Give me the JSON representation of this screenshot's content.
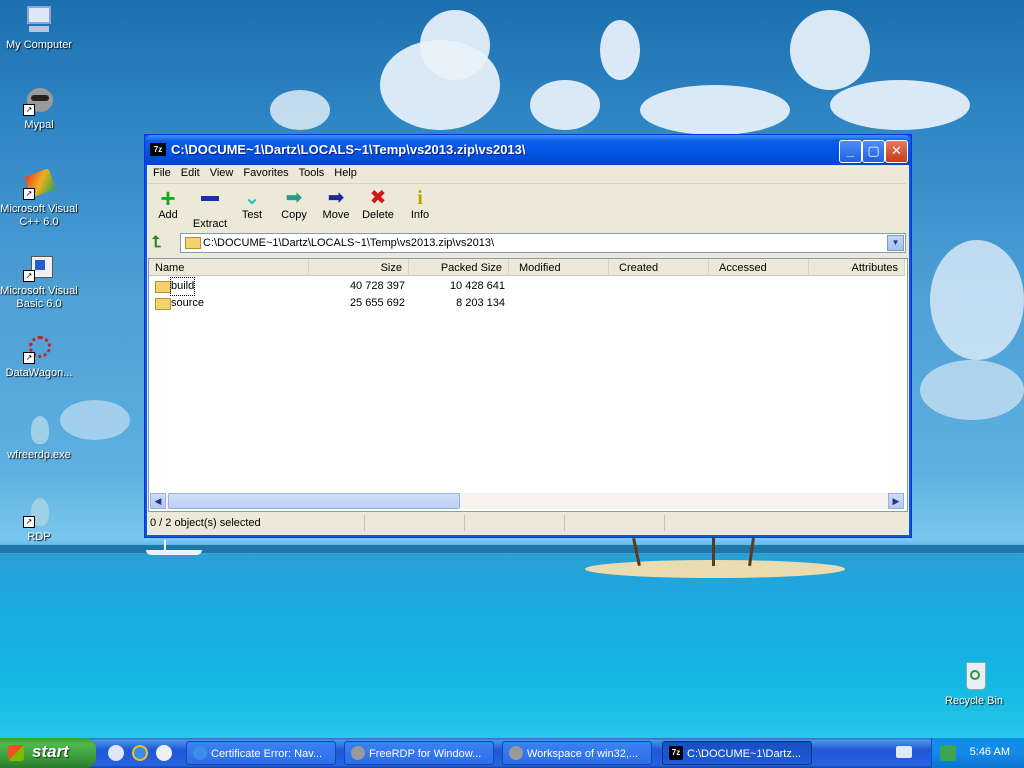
{
  "desktop": {
    "icons": [
      {
        "label": "My Computer",
        "icon": "my-computer-icon"
      },
      {
        "label": "Mypal",
        "icon": "raccoon-browser-icon"
      },
      {
        "label": "Microsoft Visual C++ 6.0",
        "icon": "visual-cpp-icon"
      },
      {
        "label": "Microsoft Visual Basic 6.0",
        "icon": "visual-basic-icon"
      },
      {
        "label": "DataWagon...",
        "icon": "datawagon-icon"
      },
      {
        "label": "wfreerdp.exe",
        "icon": "freerdp-icon"
      },
      {
        "label": "RDP",
        "icon": "freerdp-icon"
      },
      {
        "label": "Recycle Bin",
        "icon": "recycle-bin-icon"
      }
    ]
  },
  "window": {
    "app_icon": "7z",
    "title": "C:\\DOCUME~1\\Dartz\\LOCALS~1\\Temp\\vs2013.zip\\vs2013\\",
    "menu": [
      "File",
      "Edit",
      "View",
      "Favorites",
      "Tools",
      "Help"
    ],
    "toolbar": [
      {
        "label": "Add",
        "icon": "plus-icon",
        "color": "#1fa61f"
      },
      {
        "label": "Extract",
        "icon": "minus-icon",
        "color": "#1a2fb0"
      },
      {
        "label": "Test",
        "icon": "check-icon",
        "color": "#2cc0c0"
      },
      {
        "label": "Copy",
        "icon": "copy-arrow-icon",
        "color": "#2a9a8a"
      },
      {
        "label": "Move",
        "icon": "move-arrow-icon",
        "color": "#1a2a9a"
      },
      {
        "label": "Delete",
        "icon": "delete-x-icon",
        "color": "#d01818"
      },
      {
        "label": "Info",
        "icon": "info-icon",
        "color": "#c0a000"
      }
    ],
    "address": "C:\\DOCUME~1\\Dartz\\LOCALS~1\\Temp\\vs2013.zip\\vs2013\\",
    "columns": [
      "Name",
      "Size",
      "Packed Size",
      "Modified",
      "Created",
      "Accessed",
      "Attributes"
    ],
    "rows": [
      {
        "name": "build",
        "size": "40 728 397",
        "packed": "10 428 641"
      },
      {
        "name": "source",
        "size": "25 655 692",
        "packed": "8 203 134"
      }
    ],
    "status": "0 / 2 object(s) selected"
  },
  "taskbar": {
    "start_label": "start",
    "tasks": [
      {
        "label": "Certificate Error: Nav...",
        "icon": "ie-icon"
      },
      {
        "label": "FreeRDP for Window...",
        "icon": "raccoon-browser-icon"
      },
      {
        "label": "Workspace of win32,...",
        "icon": "raccoon-browser-icon"
      },
      {
        "label": "C:\\DOCUME~1\\Dartz...",
        "icon": "7z"
      }
    ],
    "clock": "5:46 AM"
  },
  "colors": {
    "title_blue": "#0054e3",
    "taskbar_blue": "#2157d7",
    "start_green": "#389838",
    "folder_yellow": "#f2d36b"
  }
}
